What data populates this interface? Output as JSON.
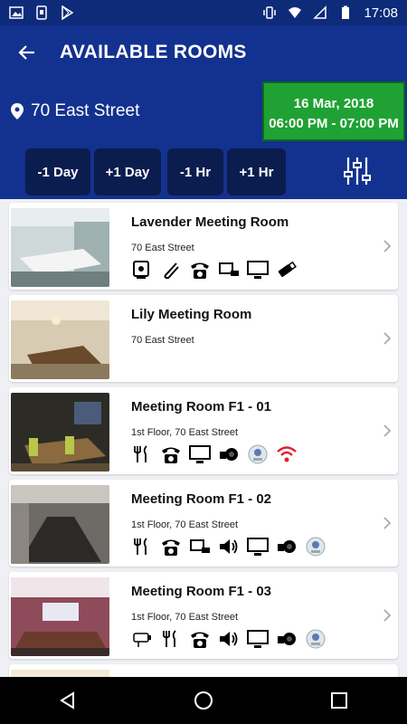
{
  "status_bar": {
    "time": "17:08"
  },
  "header": {
    "title": "AVAILABLE ROOMS"
  },
  "location": {
    "name": "70 East Street"
  },
  "schedule": {
    "date": "16 Mar, 2018",
    "time_range": "06:00 PM - 07:00 PM"
  },
  "controls": {
    "minus_day": "-1 Day",
    "plus_day": "+1 Day",
    "minus_hr": "-1 Hr",
    "plus_hr": "+1 Hr"
  },
  "rooms": [
    {
      "name": "Lavender Meeting Room",
      "address": "70 East Street",
      "amenities": [
        "presenter-icon",
        "clip-icon",
        "phone-icon",
        "projector-icon",
        "monitor-icon",
        "usb-icon"
      ]
    },
    {
      "name": "Lily Meeting Room",
      "address": "70 East Street",
      "amenities": []
    },
    {
      "name": "Meeting Room F1 - 01",
      "address": "1st Floor, 70 East Street",
      "amenities": [
        "cutlery-icon",
        "phone-icon",
        "monitor-icon",
        "camera-icon",
        "webcam-icon",
        "wifi-icon"
      ]
    },
    {
      "name": "Meeting Room F1 - 02",
      "address": "1st Floor, 70 East Street",
      "amenities": [
        "cutlery-icon",
        "phone-icon",
        "projector-icon",
        "speaker-icon",
        "monitor-icon",
        "camera-icon",
        "webcam-icon"
      ]
    },
    {
      "name": "Meeting Room F1 - 03",
      "address": "1st Floor, 70 East Street",
      "amenities": [
        "cctv-icon",
        "cutlery-icon",
        "phone-icon",
        "speaker-icon",
        "monitor-icon",
        "camera-icon",
        "webcam-icon"
      ]
    }
  ],
  "colors": {
    "header": "#13318e",
    "status": "#0e2b7a",
    "date_box": "#1fa233",
    "ctrl_btn": "#0b1d4e",
    "wifi": "#e01f2e"
  }
}
